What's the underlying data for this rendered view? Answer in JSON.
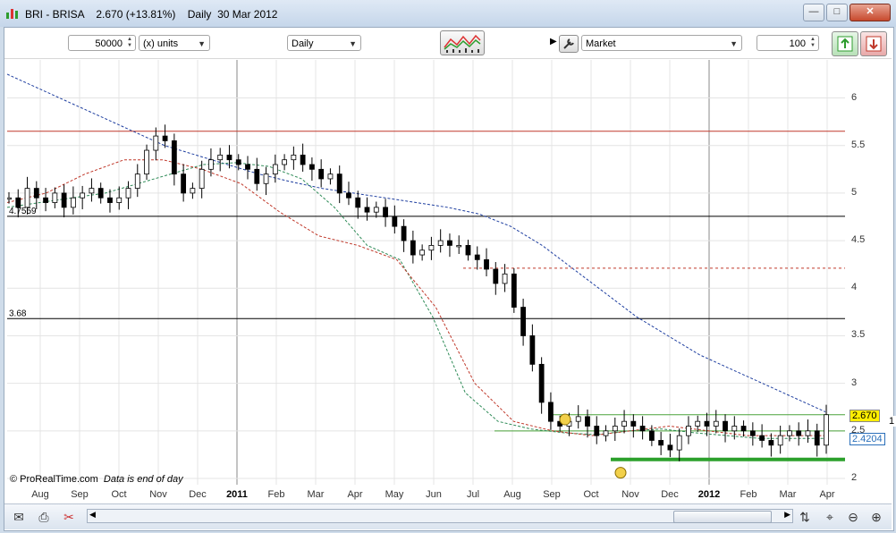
{
  "window": {
    "title": "BRI - BRISA    2.670 (+13.81%)    Daily  30 Mar 2012",
    "controls": {
      "minimize": "—",
      "maximize": "□",
      "close": "✕"
    }
  },
  "toolbar": {
    "quantity": "50000",
    "unit_select": "(x) units",
    "period_select": "Daily",
    "order_type": "Market",
    "order_qty": "100"
  },
  "chart": {
    "credit": "© ProRealTime.com",
    "credit_note": "Data is end of day",
    "left_labels": [
      "4.7559",
      "3.68"
    ],
    "last_price": "2.670",
    "ma_value": "2.4204",
    "partial_tag": "1"
  },
  "chart_data": {
    "type": "candlestick",
    "ylim": [
      2.0,
      6.4
    ],
    "yticks": [
      "6",
      "5.5",
      "5",
      "4.5",
      "4",
      "3.5",
      "3",
      "2.5",
      "2"
    ],
    "xticks": [
      "Aug",
      "Sep",
      "Oct",
      "Nov",
      "Dec",
      "2011",
      "Feb",
      "Mar",
      "Apr",
      "May",
      "Jun",
      "Jul",
      "Aug",
      "Sep",
      "Oct",
      "Nov",
      "Dec",
      "2012",
      "Feb",
      "Mar",
      "Apr"
    ],
    "x_year_ticks": [
      "2011",
      "2012"
    ],
    "horizontal_lines": [
      {
        "value": 5.65,
        "color": "#c0392b",
        "style": "solid"
      },
      {
        "value": 4.7559,
        "color": "#000000",
        "style": "solid"
      },
      {
        "value": 4.21,
        "color": "#c0392b",
        "style": "dashed"
      },
      {
        "value": 3.68,
        "color": "#000000",
        "style": "solid"
      },
      {
        "value": 2.67,
        "color": "#4aa23a",
        "style": "thin"
      },
      {
        "value": 2.5,
        "color": "#4aa23a",
        "style": "thin"
      },
      {
        "value": 2.2,
        "color": "#2ca02c",
        "style": "thick"
      }
    ],
    "close_series": [
      4.95,
      4.85,
      5.05,
      4.95,
      4.9,
      5.0,
      4.85,
      4.95,
      5.0,
      5.05,
      4.95,
      4.9,
      4.95,
      5.05,
      5.2,
      5.45,
      5.6,
      5.55,
      5.2,
      5.0,
      5.05,
      5.25,
      5.35,
      5.4,
      5.35,
      5.3,
      5.25,
      5.1,
      5.2,
      5.3,
      5.35,
      5.4,
      5.3,
      5.25,
      5.15,
      5.2,
      5.0,
      4.95,
      4.85,
      4.8,
      4.85,
      4.75,
      4.65,
      4.5,
      4.35,
      4.4,
      4.45,
      4.5,
      4.45,
      4.45,
      4.35,
      4.3,
      4.2,
      4.05,
      4.15,
      3.8,
      3.5,
      3.2,
      2.8,
      2.6,
      2.55,
      2.6,
      2.65,
      2.55,
      2.45,
      2.5,
      2.55,
      2.6,
      2.55,
      2.5,
      2.4,
      2.35,
      2.3,
      2.45,
      2.55,
      2.6,
      2.55,
      2.6,
      2.5,
      2.55,
      2.5,
      2.45,
      2.4,
      2.35,
      2.45,
      2.5,
      2.45,
      2.5,
      2.35,
      2.67
    ],
    "moving_averages": [
      {
        "color": "#1f3fa0",
        "style": "dashed",
        "values": [
          6.25,
          6.1,
          5.95,
          5.8,
          5.65,
          5.5,
          5.4,
          5.3,
          5.2,
          5.12,
          5.05,
          5.0,
          4.95,
          4.9,
          4.85,
          4.78,
          4.65,
          4.45,
          4.2,
          3.95,
          3.7,
          3.5,
          3.3,
          3.15,
          3.0,
          2.85,
          2.7
        ]
      },
      {
        "color": "#2e8b57",
        "style": "dashed",
        "values": [
          4.85,
          4.9,
          4.95,
          5.0,
          5.1,
          5.2,
          5.3,
          5.32,
          5.28,
          5.15,
          4.85,
          4.45,
          4.3,
          3.7,
          2.9,
          2.6,
          2.52,
          2.48,
          2.46,
          2.5,
          2.52,
          2.48,
          2.45,
          2.42,
          2.42,
          2.42
        ]
      },
      {
        "color": "#c0392b",
        "style": "dashed",
        "values": [
          4.9,
          5.0,
          5.2,
          5.35,
          5.35,
          5.25,
          5.1,
          4.8,
          4.55,
          4.45,
          4.3,
          3.8,
          3.0,
          2.6,
          2.5,
          2.45,
          2.5,
          2.55,
          2.5,
          2.45,
          2.45,
          2.45
        ]
      }
    ]
  },
  "statusbar": {
    "icons": [
      "mail-icon",
      "print-icon",
      "tools-icon"
    ]
  }
}
